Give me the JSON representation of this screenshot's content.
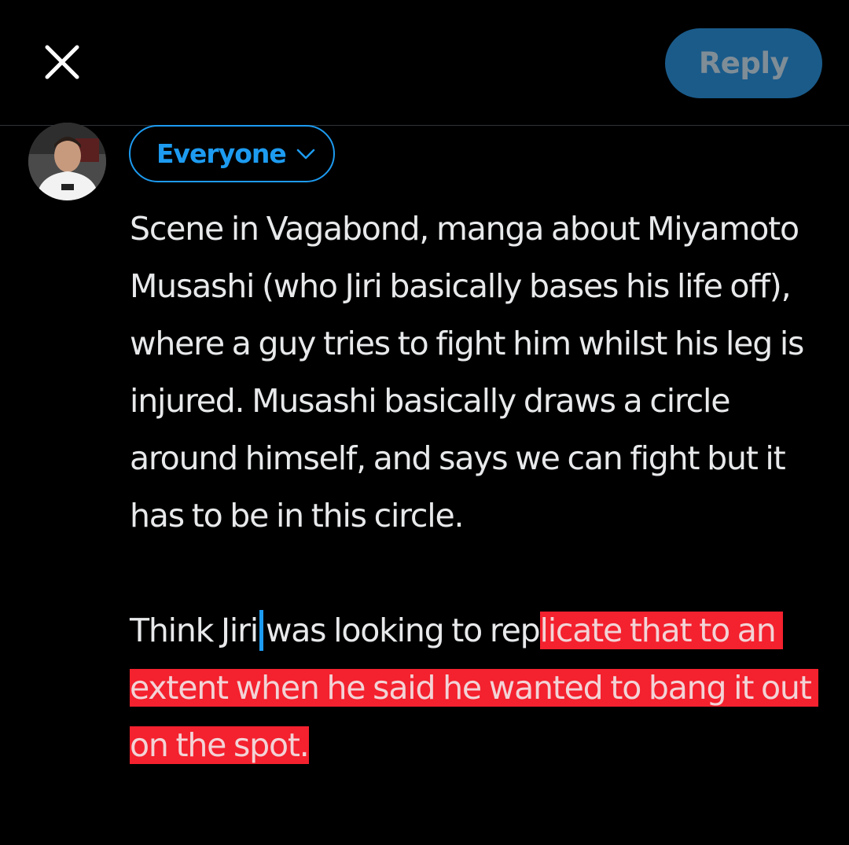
{
  "header": {
    "close_icon": "close-icon",
    "reply_label": "Reply"
  },
  "composer": {
    "avatar_icon": "user-avatar",
    "audience_label": "Everyone",
    "audience_icon": "chevron-down-icon",
    "paragraph1": "Scene in Vagabond, manga about Miyamoto Musashi (who Jiri basically bases his life off), where a guy tries to fight him whilst his leg is injured. Musashi basically draws a circle around himself, and says we can fight but it has to be in this circle.",
    "paragraph2_before_caret": "Think Jiri",
    "paragraph2_after_caret": "was looking to rep",
    "paragraph2_highlighted": "licate that to an extent when he said he wanted to bang it out on the spot.",
    "caret_color": "#1d9bf0",
    "highlight_color": "#f4212e"
  },
  "colors": {
    "background": "#000000",
    "accent": "#1d9bf0",
    "reply_button_bg": "#1a5b8a",
    "text": "#e7e9ea"
  }
}
